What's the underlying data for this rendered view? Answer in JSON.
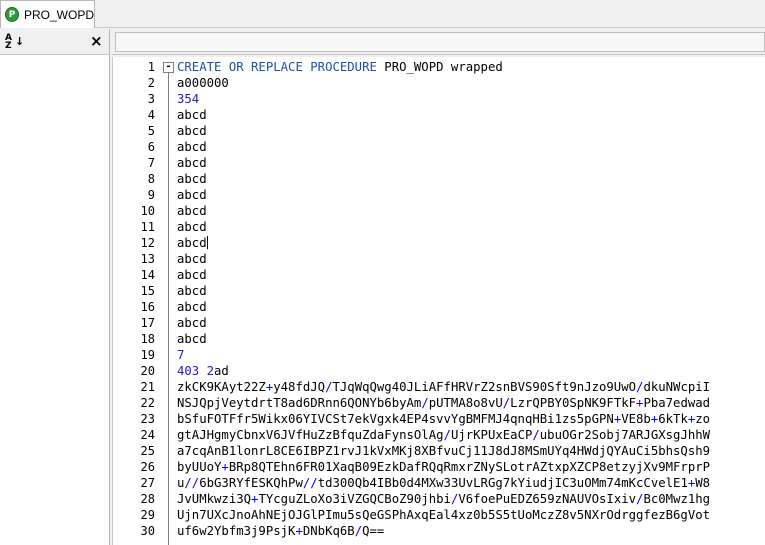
{
  "tab": {
    "label": "PRO_WOPD",
    "icon": "procedure-icon"
  },
  "left_panel": {
    "sort_icon": "sort-az-icon",
    "close_icon": "close-icon",
    "close_glyph": "×"
  },
  "editor": {
    "fold_glyph": "-",
    "lines": [
      {
        "n": "1",
        "segs": [
          [
            "kw",
            "CREATE OR REPLACE PROCEDURE"
          ],
          [
            "t",
            " PRO_WOPD wrapped"
          ]
        ]
      },
      {
        "n": "2",
        "segs": [
          [
            "t",
            "a000000"
          ]
        ]
      },
      {
        "n": "3",
        "segs": [
          [
            "num",
            "354"
          ]
        ]
      },
      {
        "n": "4",
        "segs": [
          [
            "t",
            "abcd"
          ]
        ]
      },
      {
        "n": "5",
        "segs": [
          [
            "t",
            "abcd"
          ]
        ]
      },
      {
        "n": "6",
        "segs": [
          [
            "t",
            "abcd"
          ]
        ]
      },
      {
        "n": "7",
        "segs": [
          [
            "t",
            "abcd"
          ]
        ]
      },
      {
        "n": "8",
        "segs": [
          [
            "t",
            "abcd"
          ]
        ]
      },
      {
        "n": "9",
        "segs": [
          [
            "t",
            "abcd"
          ]
        ]
      },
      {
        "n": "10",
        "segs": [
          [
            "t",
            "abcd"
          ]
        ]
      },
      {
        "n": "11",
        "segs": [
          [
            "t",
            "abcd"
          ]
        ]
      },
      {
        "n": "12",
        "segs": [
          [
            "t",
            "abcd"
          ]
        ],
        "caret": true
      },
      {
        "n": "13",
        "segs": [
          [
            "t",
            "abcd"
          ]
        ]
      },
      {
        "n": "14",
        "segs": [
          [
            "t",
            "abcd"
          ]
        ]
      },
      {
        "n": "15",
        "segs": [
          [
            "t",
            "abcd"
          ]
        ]
      },
      {
        "n": "16",
        "segs": [
          [
            "t",
            "abcd"
          ]
        ]
      },
      {
        "n": "17",
        "segs": [
          [
            "t",
            "abcd"
          ]
        ]
      },
      {
        "n": "18",
        "segs": [
          [
            "t",
            "abcd"
          ]
        ]
      },
      {
        "n": "19",
        "segs": [
          [
            "num",
            "7"
          ]
        ]
      },
      {
        "n": "20",
        "segs": [
          [
            "num",
            "403 2"
          ],
          [
            "t",
            "ad"
          ]
        ]
      },
      {
        "n": "21",
        "segs": [
          [
            "t",
            "zkCK9KAyt22Z"
          ],
          [
            "op",
            "+"
          ],
          [
            "t",
            "y48fdJQ"
          ],
          [
            "op",
            "/"
          ],
          [
            "t",
            "TJqWqQwg40JLiAFfHRVrZ2snBVS90Sft9nJzo9UwO"
          ],
          [
            "op",
            "/"
          ],
          [
            "t",
            "dkuNWcpiI"
          ]
        ]
      },
      {
        "n": "22",
        "segs": [
          [
            "t",
            "NSJQpjVeytdrtT8ad6DRnn6QONYb6byAm"
          ],
          [
            "op",
            "/"
          ],
          [
            "t",
            "pUTMA8o8vU"
          ],
          [
            "op",
            "/"
          ],
          [
            "t",
            "LzrQPBY0SpNK9FTkF"
          ],
          [
            "op",
            "+"
          ],
          [
            "t",
            "Pba7edwad"
          ]
        ]
      },
      {
        "n": "23",
        "segs": [
          [
            "t",
            "bSfuFOTFfr5Wikx06YIVCSt7ekVgxk4EP4svvYgBMFMJ4qnqHBi1zs5pGPN"
          ],
          [
            "op",
            "+"
          ],
          [
            "t",
            "VE8b"
          ],
          [
            "op",
            "+"
          ],
          [
            "t",
            "6kTk"
          ],
          [
            "op",
            "+"
          ],
          [
            "t",
            "zo"
          ]
        ]
      },
      {
        "n": "24",
        "segs": [
          [
            "t",
            "gtAJHgmyCbnxV6JVfHuZzBfquZdaFynsOlAg"
          ],
          [
            "op",
            "/"
          ],
          [
            "t",
            "UjrKPUxEaCP"
          ],
          [
            "op",
            "/"
          ],
          [
            "t",
            "ubuOGr2Sobj7ARJGXsgJhhW"
          ]
        ]
      },
      {
        "n": "25",
        "segs": [
          [
            "t",
            "a7cqAnB1lonrL8CE6IBPZ1rvJ1kVxMKj8XBfvuCj11J8dJ8MSmUYq4HWdjQYAuCi5bhsQsh9"
          ]
        ]
      },
      {
        "n": "26",
        "segs": [
          [
            "t",
            "byUUoY"
          ],
          [
            "op",
            "+"
          ],
          [
            "t",
            "BRp8QTEhn6FR01XaqB09EzkDafRQqRmxrZNySLotrAZtxpXZCP8etzyjXv9MFrprP"
          ]
        ]
      },
      {
        "n": "27",
        "segs": [
          [
            "t",
            "u"
          ],
          [
            "op",
            "//"
          ],
          [
            "t",
            "6bG3RYfESKQhPw"
          ],
          [
            "op",
            "//"
          ],
          [
            "t",
            "td300Qb4IBb0d4MXw33UvLRGg7kYiudjIC3uOMm74mKcCvelE1"
          ],
          [
            "op",
            "+"
          ],
          [
            "t",
            "W8"
          ]
        ]
      },
      {
        "n": "28",
        "segs": [
          [
            "t",
            "JvUMkwzi3Q"
          ],
          [
            "op",
            "+"
          ],
          [
            "t",
            "TYcguZLoXo3iVZGQCBoZ90jhbi"
          ],
          [
            "op",
            "/"
          ],
          [
            "t",
            "V6foePuEDZ659zNAUVOsIxiv"
          ],
          [
            "op",
            "/"
          ],
          [
            "t",
            "Bc0Mwz1hg"
          ]
        ]
      },
      {
        "n": "29",
        "segs": [
          [
            "t",
            "Ujn7UXcJnoAhNEjOJGlPImu5sQeGSPhAxqEal4xz0b5S5tUoMczZ8v5NXrOdrggfezB6gVot"
          ]
        ]
      },
      {
        "n": "30",
        "segs": [
          [
            "t",
            "uf6w2Ybfm3j9PsjK"
          ],
          [
            "op",
            "+"
          ],
          [
            "t",
            "DNbKq6B"
          ],
          [
            "op",
            "/"
          ],
          [
            "t",
            "Q=="
          ]
        ]
      }
    ]
  },
  "colors": {
    "keyword": "#1e4fa8",
    "number": "#2020c0",
    "operator": "#0000ff",
    "tab_icon": "#2e9b3a"
  }
}
